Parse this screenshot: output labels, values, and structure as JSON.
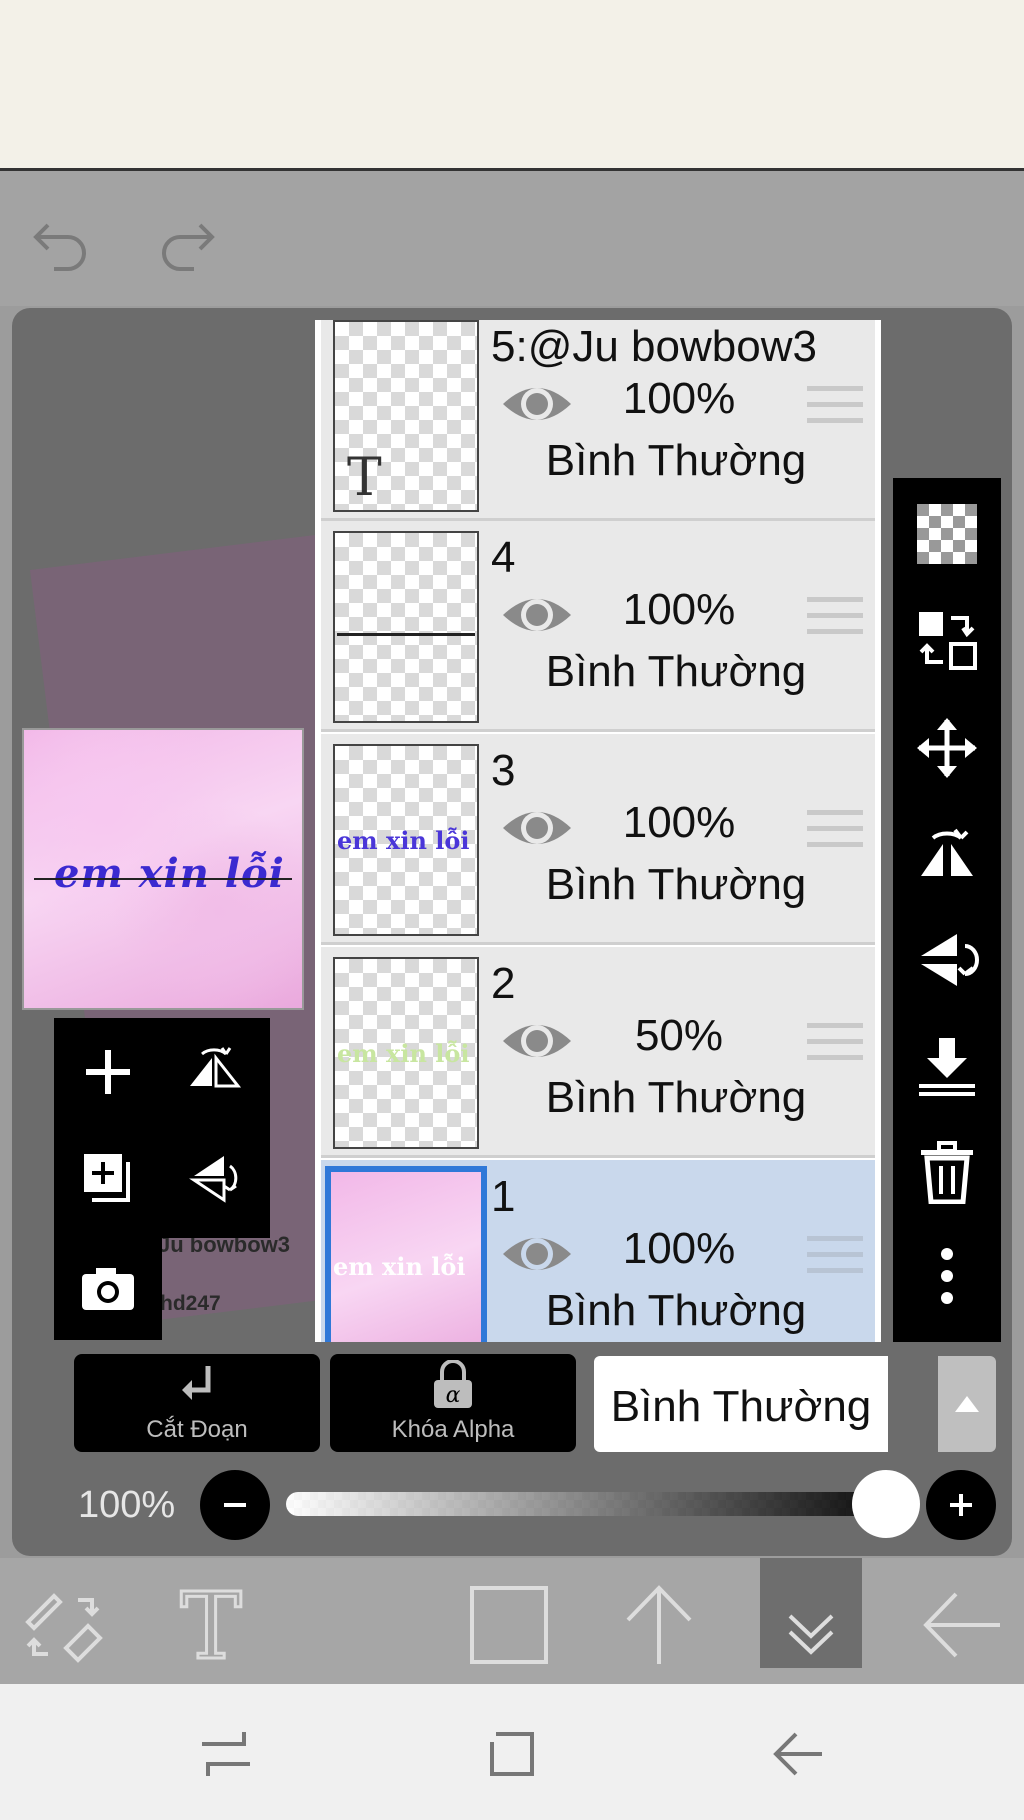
{
  "colors": {
    "selection_blue": "#2f78d8",
    "selected_row": "#c9d8ec",
    "toolbar_black": "#000000",
    "panel_gray": "#6c6c6c"
  },
  "canvas": {
    "watermark_line1": "Ju bowbow3",
    "watermark_line2": "hd247",
    "preview_script": "em xin lỗi"
  },
  "layers": [
    {
      "id": "5",
      "name": "5:@Ju bowbow3",
      "opacity": "100%",
      "blend": "Bình Thường",
      "kind": "text",
      "visible": true,
      "selected": false
    },
    {
      "id": "4",
      "name": "4",
      "opacity": "100%",
      "blend": "Bình Thường",
      "kind": "line",
      "visible": true,
      "selected": false
    },
    {
      "id": "3",
      "name": "3",
      "opacity": "100%",
      "blend": "Bình Thường",
      "kind": "script",
      "thumb_text": "em xin lỗi",
      "visible": true,
      "selected": false
    },
    {
      "id": "2",
      "name": "2",
      "opacity": "50%",
      "blend": "Bình Thường",
      "kind": "script",
      "thumb_text": "em xin lỗi",
      "visible": true,
      "selected": false
    },
    {
      "id": "1",
      "name": "1",
      "opacity": "100%",
      "blend": "Bình Thường",
      "kind": "image",
      "thumb_text": "em xin lỗi",
      "visible": true,
      "selected": true
    }
  ],
  "layer_options": {
    "clipping_label": "Cắt Đoạn",
    "alpha_lock_label": "Khóa Alpha",
    "blend_mode_value": "Bình Thường"
  },
  "opacity_slider": {
    "label": "100%",
    "value": 1.0
  },
  "icons": {
    "undo": "undo-icon",
    "redo": "redo-icon",
    "add_layer": "plus-icon",
    "flip_h": "flip-horizontal-icon",
    "duplicate": "duplicate-layer-icon",
    "flip_v": "flip-vertical-icon",
    "camera": "camera-icon",
    "checker": "transparency-icon",
    "swap": "swap-icon",
    "move": "move-icon",
    "merge": "merge-down-icon",
    "trash": "trash-icon",
    "more": "more-vert-icon"
  }
}
